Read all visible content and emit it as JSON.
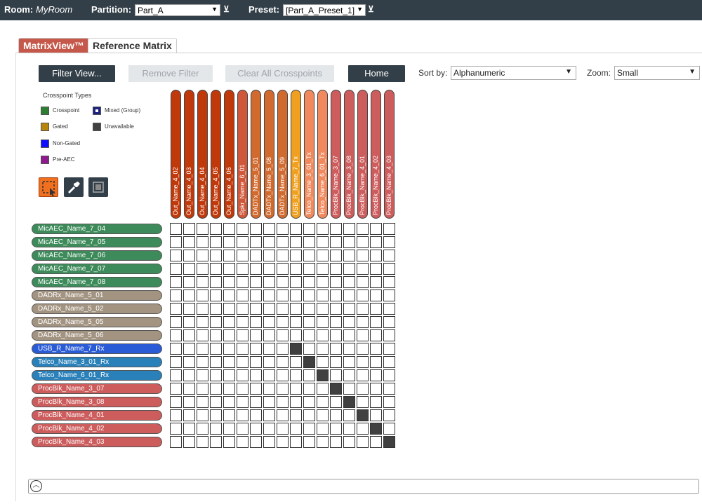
{
  "topbar": {
    "room_label": "Room:",
    "room_value": "MyRoom",
    "partition_label": "Partition:",
    "partition_value": "Part_A",
    "preset_label": "Preset:",
    "preset_value": "[Part_A_Preset_1]"
  },
  "tabs": [
    {
      "label": "MatrixView™",
      "active": true
    },
    {
      "label": "Reference Matrix",
      "active": false
    }
  ],
  "toolbar": {
    "filter_view": "Filter View...",
    "remove_filter": "Remove Filter",
    "clear_crosspoints": "Clear All Crosspoints",
    "home": "Home",
    "sort_label": "Sort by:",
    "sort_value": "Alphanumeric",
    "zoom_label": "Zoom:",
    "zoom_value": "Small"
  },
  "legend": {
    "title": "Crosspoint Types",
    "items": [
      {
        "label": "Crosspoint",
        "color": "#2e7d32"
      },
      {
        "label": "Mixed (Group)",
        "color": "#1a237e"
      },
      {
        "label": "Gated",
        "color": "#b8860b"
      },
      {
        "label": "Unavailable",
        "color": "#404040"
      },
      {
        "label": "Non-Gated",
        "color": "#0d0dff"
      },
      {
        "label": "Pre-AEC",
        "color": "#8e1a8e"
      }
    ]
  },
  "tools": [
    {
      "icon": "select-region-icon",
      "color": "#f07020"
    },
    {
      "icon": "paint-brush-icon",
      "color": "#333f48"
    },
    {
      "icon": "stamp-icon",
      "color": "#333f48"
    }
  ],
  "columns": [
    {
      "label": "Out_Name_4_02",
      "color": "#c0390b"
    },
    {
      "label": "Out_Name_4_03",
      "color": "#c0390b"
    },
    {
      "label": "Out_Name_4_04",
      "color": "#c0390b"
    },
    {
      "label": "Out_Name_4_05",
      "color": "#c0390b"
    },
    {
      "label": "Out_Name_4_06",
      "color": "#c0390b"
    },
    {
      "label": "Spkr_Name_6_01",
      "color": "#d0583a"
    },
    {
      "label": "DADTx_Name_5_01",
      "color": "#d06a2e"
    },
    {
      "label": "DADTx_Name_5_08",
      "color": "#d06a2e"
    },
    {
      "label": "DADTx_Name_5_09",
      "color": "#d06a2e"
    },
    {
      "label": "USB_R_Name_7_Tx",
      "color": "#f0a020"
    },
    {
      "label": "Telco_Name_3_01_Tx",
      "color": "#f08a5e"
    },
    {
      "label": "Telco_Name_6_01_Tx",
      "color": "#f08a5e"
    },
    {
      "label": "ProcBlk_Name_3_07",
      "color": "#cd5c5c"
    },
    {
      "label": "ProcBlk_Name_3_08",
      "color": "#cd5c5c"
    },
    {
      "label": "ProcBlk_Name_4_01",
      "color": "#cd5c5c"
    },
    {
      "label": "ProcBlk_Name_4_02",
      "color": "#cd5c5c"
    },
    {
      "label": "ProcBlk_Name_4_03",
      "color": "#cd5c5c"
    }
  ],
  "rows": [
    {
      "label": "MicAEC_Name_7_04",
      "color": "#3d8b5a"
    },
    {
      "label": "MicAEC_Name_7_05",
      "color": "#3d8b5a"
    },
    {
      "label": "MicAEC_Name_7_06",
      "color": "#3d8b5a"
    },
    {
      "label": "MicAEC_Name_7_07",
      "color": "#3d8b5a"
    },
    {
      "label": "MicAEC_Name_7_08",
      "color": "#3d8b5a"
    },
    {
      "label": "DADRx_Name_5_01",
      "color": "#a39482"
    },
    {
      "label": "DADRx_Name_5_02",
      "color": "#a39482"
    },
    {
      "label": "DADRx_Name_5_05",
      "color": "#a39482"
    },
    {
      "label": "DADRx_Name_5_06",
      "color": "#a39482"
    },
    {
      "label": "USB_R_Name_7_Rx",
      "color": "#2a5bd7"
    },
    {
      "label": "Telco_Name_3_01_Rx",
      "color": "#2a80b9"
    },
    {
      "label": "Telco_Name_6_01_Rx",
      "color": "#2a80b9"
    },
    {
      "label": "ProcBlk_Name_3_07",
      "color": "#cd5c5c"
    },
    {
      "label": "ProcBlk_Name_3_08",
      "color": "#cd5c5c"
    },
    {
      "label": "ProcBlk_Name_4_01",
      "color": "#cd5c5c"
    },
    {
      "label": "ProcBlk_Name_4_02",
      "color": "#cd5c5c"
    },
    {
      "label": "ProcBlk_Name_4_03",
      "color": "#cd5c5c"
    }
  ],
  "unavailable_cells": [
    [
      9,
      9
    ],
    [
      10,
      10
    ],
    [
      11,
      11
    ],
    [
      12,
      12
    ],
    [
      13,
      13
    ],
    [
      14,
      14
    ],
    [
      15,
      15
    ],
    [
      16,
      16
    ]
  ]
}
